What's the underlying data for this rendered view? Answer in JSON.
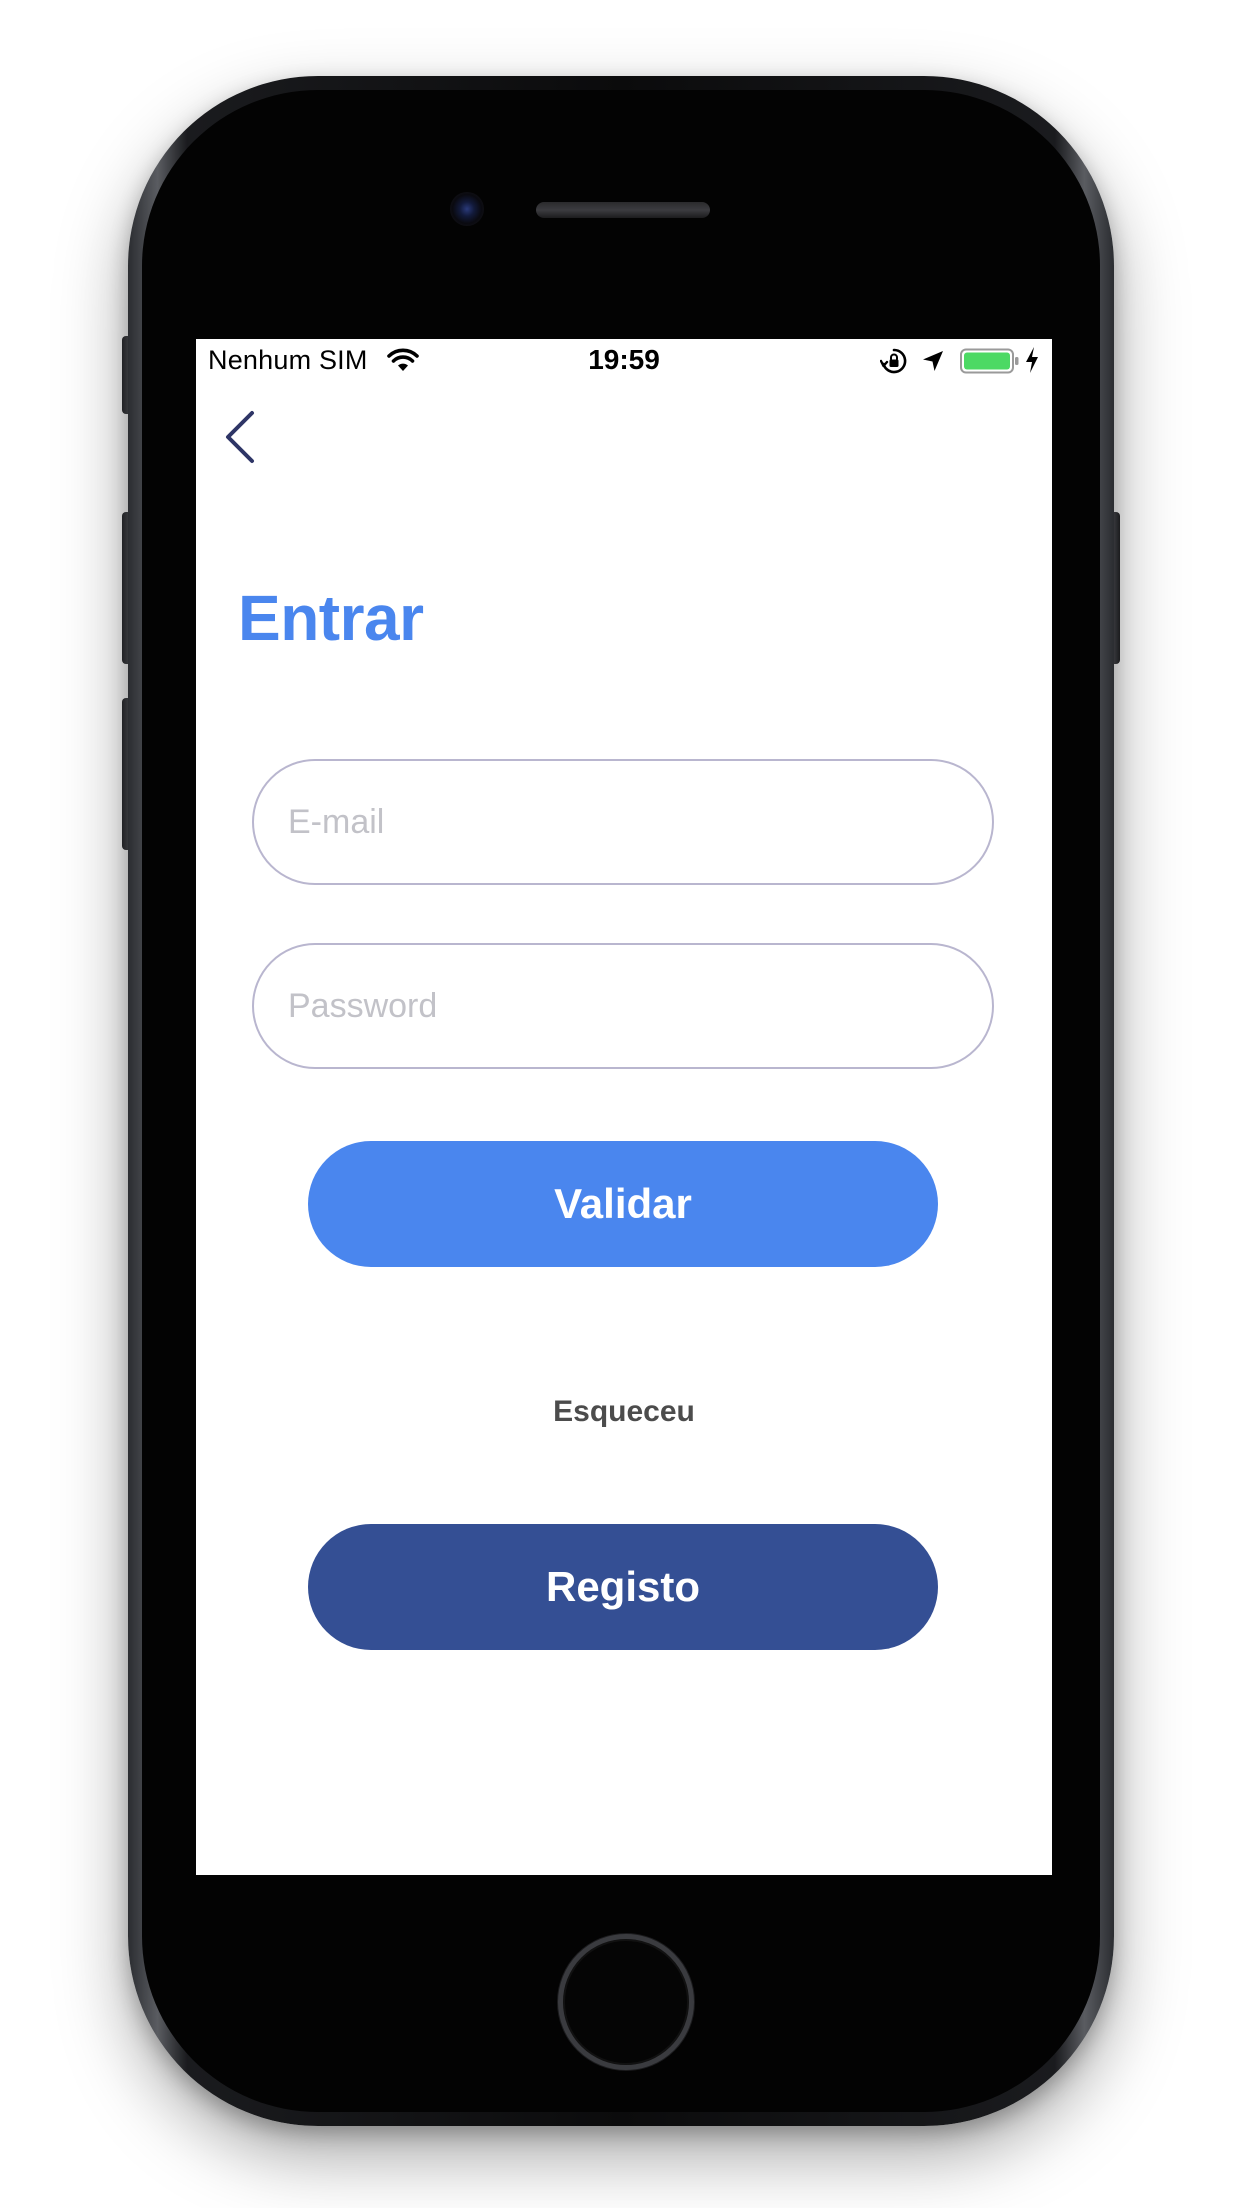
{
  "status_bar": {
    "carrier": "Nenhum SIM",
    "time": "19:59",
    "icons": [
      "wifi-icon",
      "rotation-lock-icon",
      "location-icon",
      "battery-icon",
      "charging-icon"
    ],
    "battery_color": "#4cd964"
  },
  "nav": {
    "back_icon": "chevron-left-icon"
  },
  "login": {
    "title": "Entrar",
    "email_placeholder": "E-mail",
    "email_value": "",
    "password_placeholder": "Password",
    "password_value": "",
    "validate_label": "Validar",
    "forgot_label": "Esqueceu",
    "register_label": "Registo"
  },
  "colors": {
    "accent": "#4a86ee",
    "secondary": "#344f94",
    "field_border": "#b9b6cf",
    "back_chevron": "#2e3566"
  }
}
